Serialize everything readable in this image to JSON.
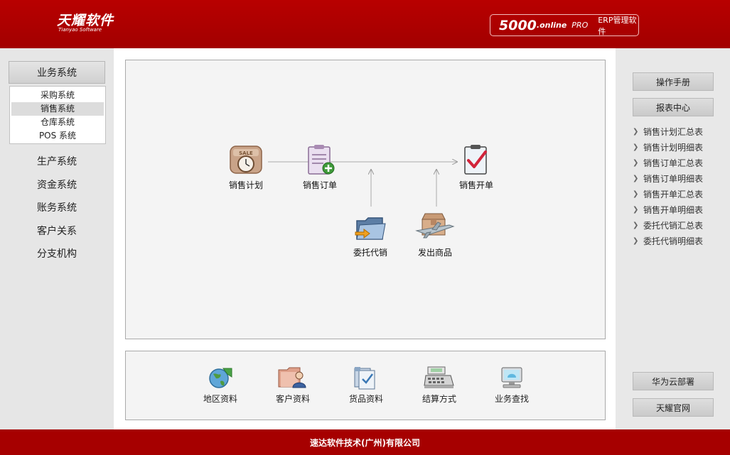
{
  "header": {
    "logo_cn": "天耀软件",
    "logo_en": "Tianyao Software",
    "product_num": "5000",
    "product_online": ".online",
    "product_pro": "PRO",
    "product_erp": "ERP管理软件"
  },
  "left_nav": {
    "header": "业务系统",
    "sub_items": [
      "采购系统",
      "销售系统",
      "仓库系统",
      "POS 系统"
    ],
    "active_sub": "销售系统",
    "main_items": [
      "生产系统",
      "资金系统",
      "账务系统",
      "客户关系",
      "分支机构"
    ]
  },
  "flow": {
    "nodes": {
      "plan": "销售计划",
      "order": "销售订单",
      "invoice": "销售开单",
      "consign": "委托代销",
      "ship": "发出商品"
    }
  },
  "tools": [
    "地区资料",
    "客户资料",
    "货品资料",
    "结算方式",
    "业务查找"
  ],
  "right": {
    "manual": "操作手册",
    "reports_center": "报表中心",
    "reports": [
      "销售计划汇总表",
      "销售计划明细表",
      "销售订单汇总表",
      "销售订单明细表",
      "销售开单汇总表",
      "销售开单明细表",
      "委托代销汇总表",
      "委托代销明细表"
    ],
    "huawei": "华为云部署",
    "official": "天耀官网"
  },
  "footer": {
    "company": "速达软件技术(广州)有限公司"
  },
  "colors": {
    "brand_red": "#a80000",
    "panel_bg": "#f4f4f4"
  }
}
